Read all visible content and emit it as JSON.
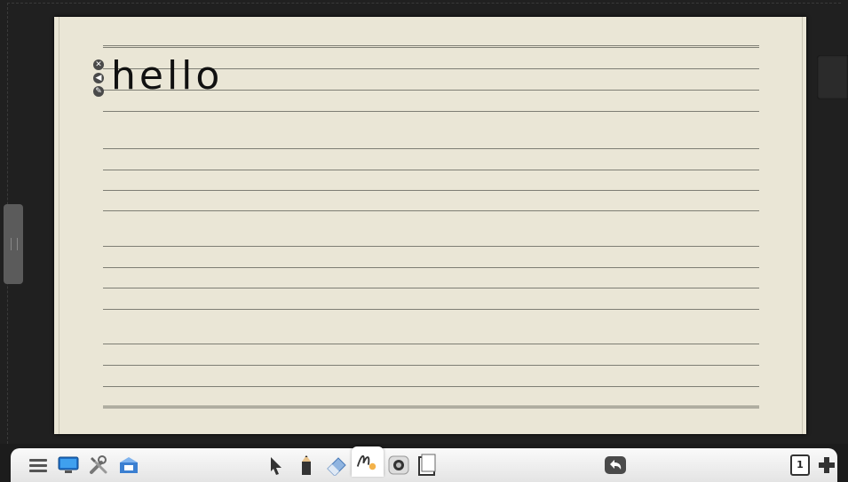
{
  "canvas": {
    "text_object": "hello",
    "text_controls": [
      "close-icon",
      "speaker-icon",
      "edit-icon"
    ]
  },
  "toolbar": {
    "left_tools": [
      "menu-icon",
      "desktop-icon",
      "tools-icon",
      "resources-icon"
    ],
    "center_tools": [
      "select-icon",
      "pen-icon",
      "eraser-icon",
      "handwriting-icon",
      "spotlight-icon",
      "page-icon"
    ],
    "active_tool": "handwriting-icon",
    "undo": "undo-icon",
    "page_number": "1",
    "add_page": "add-icon"
  },
  "colors": {
    "board": "#202020",
    "paper": "#eae6d6",
    "ruling": "#7e7e74",
    "toolbar": "#f2f2f2"
  }
}
